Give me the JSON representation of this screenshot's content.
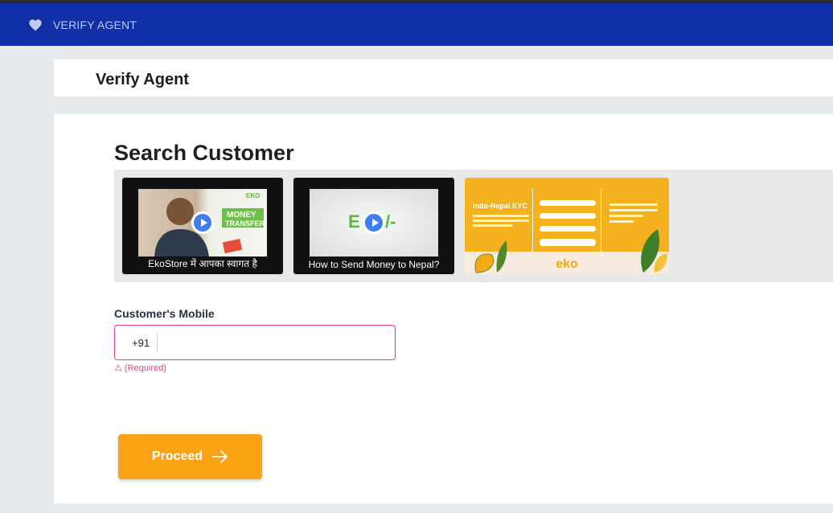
{
  "appbar": {
    "title": "VERIFY AGENT",
    "icon": "heart-icon"
  },
  "header": {
    "title": "Verify Agent"
  },
  "search": {
    "heading": "Search Customer",
    "videos": [
      {
        "caption": "EkoStore में आपका स्वागत है",
        "thumb_text_1": "MONEY",
        "thumb_text_2": "TRANSFER",
        "thumb_logo": "EKO"
      },
      {
        "caption": "How to Send Money to Nepal?",
        "thumb_logo_left": "E",
        "thumb_logo_right": "/-"
      }
    ],
    "kyc_card": {
      "title": "Indo-Nepal KYC",
      "brand": "eko"
    }
  },
  "mobile": {
    "label": "Customer's Mobile",
    "prefix": "+91",
    "value": "",
    "error": "⚠ (Required)"
  },
  "actions": {
    "proceed_label": "Proceed"
  },
  "colors": {
    "appbar": "#1130a8",
    "accent": "#fba314",
    "error": "#e2447a"
  }
}
